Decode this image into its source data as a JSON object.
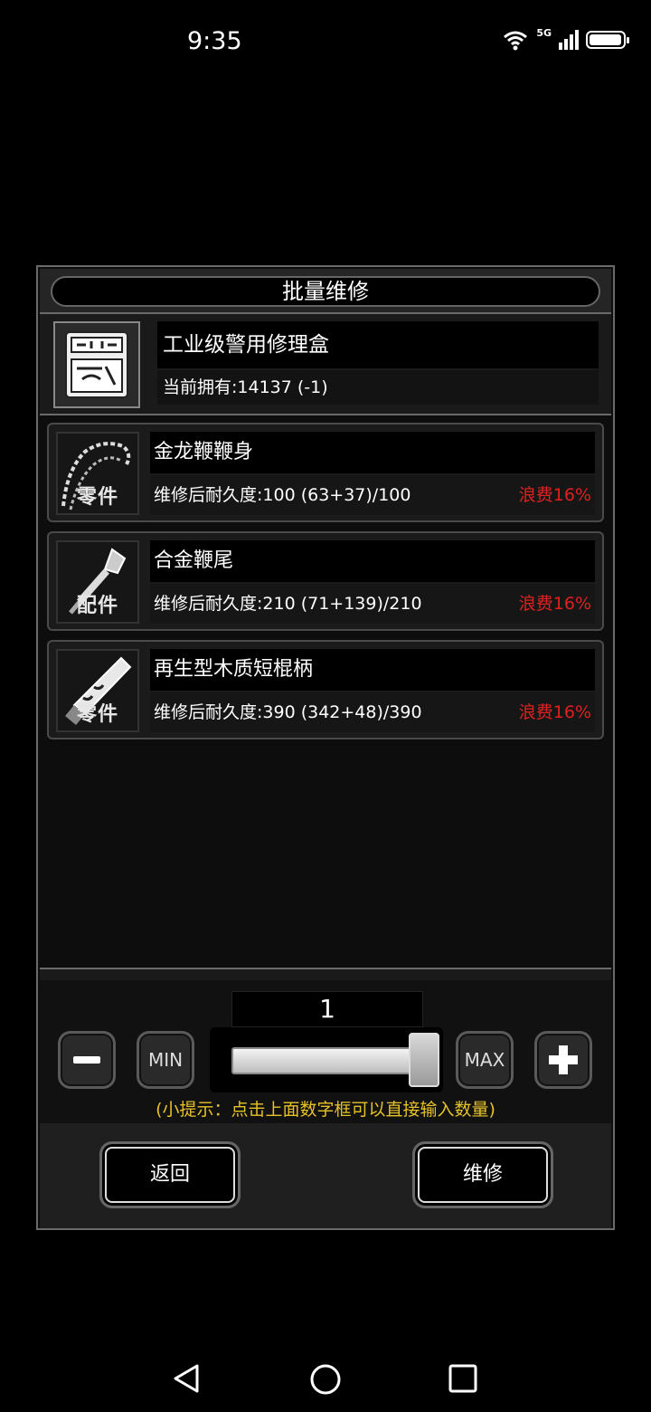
{
  "status": {
    "time": "9:35",
    "network": "5G"
  },
  "dialog": {
    "title": "批量维修",
    "kit": {
      "name": "工业级警用修理盒",
      "count_text": "当前拥有:14137 (-1)"
    },
    "items": [
      {
        "tag": "零件",
        "name": "金龙鞭鞭身",
        "durability": "维修后耐久度:100 (63+37)/100",
        "waste": "浪费16%"
      },
      {
        "tag": "配件",
        "name": "合金鞭尾",
        "durability": "维修后耐久度:210 (71+139)/210",
        "waste": "浪费16%"
      },
      {
        "tag": "零件",
        "name": "再生型木质短棍柄",
        "durability": "维修后耐久度:390 (342+48)/390",
        "waste": "浪费16%"
      }
    ],
    "quantity": "1",
    "slider_level": 1.0,
    "min_label": "MIN",
    "max_label": "MAX",
    "hint": "(小提示：点击上面数字框可以直接输入数量)",
    "back_label": "返回",
    "repair_label": "维修"
  },
  "colors": {
    "waste": "#e02020",
    "hint": "#e6c229"
  }
}
